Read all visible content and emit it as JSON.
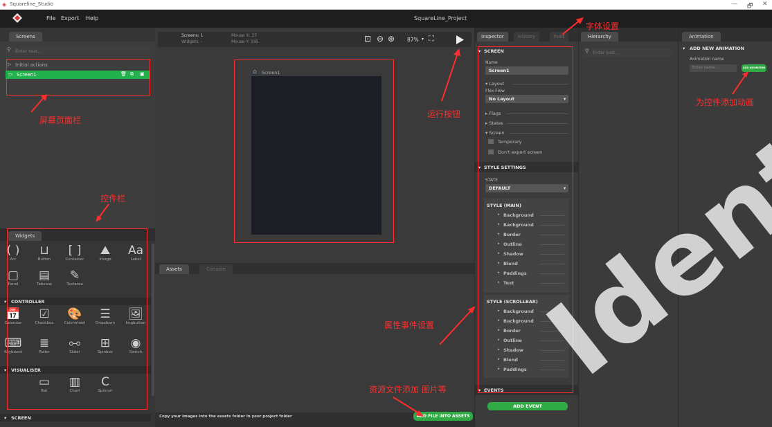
{
  "os": {
    "title": "Squareline_Studio",
    "minimize": "—",
    "maximize": "🗗",
    "close": "✕"
  },
  "menu": {
    "file": "File",
    "export": "Export",
    "help": "Help",
    "project": "SquareLine_Project"
  },
  "screens": {
    "tab": "Screens",
    "search_placeholder": "Enter text...",
    "initial_actions": "Initial actions",
    "screen1": "Screen1"
  },
  "toolbar": {
    "screens_label": "Screens: 1",
    "widgets_label": "Widgets: -",
    "mouse_x": "Mouse X: 37",
    "mouse_y": "Mouse Y: 195",
    "zoom": "87%"
  },
  "canvas": {
    "screen_label": "Screen1"
  },
  "widgets": {
    "tab": "Widgets",
    "basic": [
      {
        "icon": "( )",
        "label": "Arc"
      },
      {
        "icon": "⊔",
        "label": "Button"
      },
      {
        "icon": "[ ]",
        "label": "Container"
      },
      {
        "icon": "⛰",
        "label": "Image"
      },
      {
        "icon": "Aa",
        "label": "Label"
      },
      {
        "icon": "▢",
        "label": "Panel"
      },
      {
        "icon": "▤",
        "label": "Tabview"
      },
      {
        "icon": "✎",
        "label": "Textarea"
      }
    ],
    "controller_header": "CONTROLLER",
    "controller": [
      {
        "icon": "📅",
        "label": "Calendar"
      },
      {
        "icon": "☑",
        "label": "Checkbox"
      },
      {
        "icon": "🎨",
        "label": "Colorwheel"
      },
      {
        "icon": "☰",
        "label": "Dropdown"
      },
      {
        "icon": "🖼",
        "label": "Imgbutton"
      },
      {
        "icon": "⌨",
        "label": "Keyboard"
      },
      {
        "icon": "≣",
        "label": "Roller"
      },
      {
        "icon": "⧟",
        "label": "Slider"
      },
      {
        "icon": "⊞",
        "label": "Spinbox"
      },
      {
        "icon": "◉",
        "label": "Switch"
      }
    ],
    "visualiser_header": "VISUALISER",
    "visualiser": [
      {
        "icon": "▭",
        "label": "Bar"
      },
      {
        "icon": "▥",
        "label": "Chart"
      },
      {
        "icon": "C",
        "label": "Spinner"
      }
    ],
    "screen_header": "SCREEN"
  },
  "assets": {
    "tab_assets": "Assets",
    "tab_console": "Console",
    "hint": "Copy your images into the assets folder in your project folder",
    "add_button": "ADD FILE INTO ASSETS"
  },
  "inspector": {
    "tab_inspector": "Inspector",
    "tab_history": "History",
    "tab_font": "Font",
    "screen_header": "SCREEN",
    "name_label": "Name",
    "name_value": "Screen1",
    "layout": "Layout",
    "flex_flow": "Flex Flow",
    "flex_value": "No Layout",
    "flags": "Flags",
    "states": "States",
    "screen_section": "Screen",
    "temporary": "Temporary",
    "dont_export": "Don't export screen",
    "style_settings": "STYLE SETTINGS",
    "state_label": "STATE",
    "state_value": "DEFAULT",
    "style_main": "STYLE (MAIN)",
    "style_main_items": [
      "Background",
      "Background",
      "Border",
      "Outline",
      "Shadow",
      "Blend",
      "Paddings",
      "Text"
    ],
    "style_scrollbar": "STYLE (SCROLLBAR)",
    "style_scroll_items": [
      "Background",
      "Background",
      "Border",
      "Outline",
      "Shadow",
      "Blend",
      "Paddings"
    ],
    "events": "EVENTS",
    "add_event": "ADD EVENT"
  },
  "hierarchy": {
    "tab": "Hierarchy",
    "search_placeholder": "Enter text..."
  },
  "animation": {
    "tab": "Animation",
    "header": "ADD NEW ANIMATION",
    "name_label": "Animation name",
    "name_placeholder": "Enter name...",
    "add_button": "ADD ANIMATION"
  },
  "annotations": {
    "screens_panel": "屏幕页面栏",
    "widgets_panel": "控件栏",
    "run_button": "运行按钮",
    "font_settings": "字体设置",
    "add_animation": "为控件添加动画",
    "property_events": "属性事件设置",
    "assets_add": "资源文件添加 图片等"
  },
  "watermark": "Identity"
}
